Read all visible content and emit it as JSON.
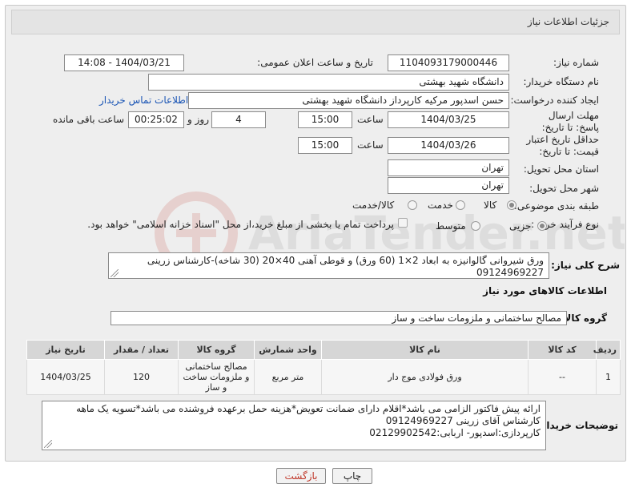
{
  "header": {
    "title": "جزئیات اطلاعات نیاز"
  },
  "form": {
    "need_number": {
      "label": "شماره نیاز:",
      "value": "1104093179000446"
    },
    "announce_datetime": {
      "label": "تاریخ و ساعت اعلان عمومی:",
      "value": "1404/03/21 - 14:08"
    },
    "buyer_org": {
      "label": "نام دستگاه خریدار:",
      "value": "دانشگاه شهید بهشتی"
    },
    "requester": {
      "label": "ایجاد کننده درخواست:",
      "value": "حسن اسدپور مرکیه کارپرداز دانشگاه شهید بهشتی",
      "contact_link": "اطلاعات تماس خریدار"
    },
    "reply_deadline": {
      "label": "مهلت ارسال پاسخ: تا تاریخ:",
      "date": "1404/03/25",
      "time_label": "ساعت",
      "time": "15:00",
      "days": "4",
      "days_label": "روز و",
      "remaining": "00:25:02",
      "remaining_label": "ساعت باقی مانده"
    },
    "price_validity": {
      "label": "حداقل تاریخ اعتبار قیمت: تا تاریخ:",
      "date": "1404/03/26",
      "time_label": "ساعت",
      "time": "15:00"
    },
    "delivery_province": {
      "label": "استان محل تحویل:",
      "value": "تهران"
    },
    "delivery_city": {
      "label": "شهر محل تحویل:",
      "value": "تهران"
    },
    "category": {
      "label": "طبقه بندی موضوعی:",
      "options": [
        "کالا",
        "خدمت",
        "کالا/خدمت"
      ],
      "selected": "کالا"
    },
    "purchase_type": {
      "label": "نوع فرآیند خرید :",
      "options": [
        "جزیی",
        "متوسط"
      ],
      "selected": "جزیی",
      "note": "پرداخت تمام یا بخشی از مبلغ خرید،از محل \"اسناد خزانه اسلامی\" خواهد بود."
    }
  },
  "description": {
    "label": "شرح کلی نیاز:",
    "text": "ورق شیروانی گالوانیزه به ابعاد 2×1 (60 ورق) و قوطی آهنی 40×20 (30 شاخه)-کارشناس زرینی 09124969227"
  },
  "goods_info": {
    "title": "اطلاعات کالاهای مورد نیاز",
    "group_label": "گروه کالا:",
    "group_value": "مصالح ساختمانی و ملزومات ساخت و ساز",
    "columns": [
      "ردیف",
      "کد کالا",
      "نام کالا",
      "واحد شمارش",
      "گروه کالا",
      "تعداد / مقدار",
      "تاریخ نیاز"
    ],
    "rows": [
      {
        "index": "1",
        "code": "--",
        "name": "ورق فولادی موج دار",
        "unit": "متر مربع",
        "group": "مصالح ساختمانی و ملزومات ساخت و ساز",
        "qty": "120",
        "date": "1404/03/25"
      }
    ]
  },
  "buyer_notes": {
    "label": "توضیحات خریدار:",
    "lines": [
      "ارائه پیش فاکتور الزامی می باشد*اقلام دارای ضمانت تعویض*هزینه حمل برعهده فروشنده می باشد*تسویه یک ماهه",
      "کارشناس آقای زرینی 09124969227",
      "کارپردازی:اسدپور- اربابی:02129902542"
    ]
  },
  "buttons": {
    "print": "چاپ",
    "back": "بازگشت"
  },
  "colors": {
    "panel_bg": "#eeeeee",
    "link": "#1a55b5",
    "back_button_text": "#c0392b"
  }
}
